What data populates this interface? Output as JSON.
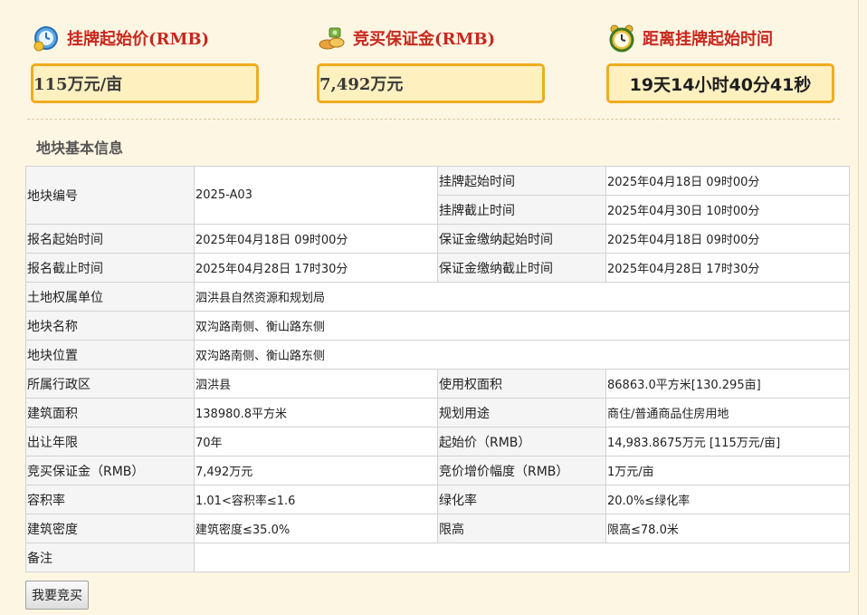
{
  "header": {
    "items": [
      {
        "icon": "clock-money-icon",
        "label": "挂牌起始价(RMB)",
        "value": "115万元/亩"
      },
      {
        "icon": "money-pile-icon",
        "label": "竞买保证金(RMB)",
        "value": "7,492万元"
      },
      {
        "icon": "alarm-clock-icon",
        "label": "距离挂牌起始时间",
        "value": "19天14小时40分41秒"
      }
    ],
    "label_color": "#c8281e",
    "box_border_color": "#f0ac20",
    "box_fill_color": "#fff0c0"
  },
  "section": {
    "title": "地块基本信息"
  },
  "table": {
    "r1": {
      "k1": "地块编号",
      "v1": "2025-A03",
      "k2a": "挂牌起始时间",
      "v2a": "2025年04月18日 09时00分",
      "k2b": "挂牌截止时间",
      "v2b": "2025年04月30日 10时00分"
    },
    "r2": {
      "k1": "报名起始时间",
      "v1": "2025年04月18日 09时00分",
      "k2": "保证金缴纳起始时间",
      "v2": "2025年04月18日 09时00分"
    },
    "r3": {
      "k1": "报名截止时间",
      "v1": "2025年04月28日 17时30分",
      "k2": "保证金缴纳截止时间",
      "v2": "2025年04月28日 17时30分"
    },
    "r4": {
      "k1": "土地权属单位",
      "v1": "泗洪县自然资源和规划局"
    },
    "r5": {
      "k1": "地块名称",
      "v1": "双沟路南侧、衡山路东侧"
    },
    "r6": {
      "k1": "地块位置",
      "v1": "双沟路南侧、衡山路东侧"
    },
    "r7": {
      "k1": "所属行政区",
      "v1": "泗洪县",
      "k2": "使用权面积",
      "v2": "86863.0平方米[130.295亩]"
    },
    "r8": {
      "k1": "建筑面积",
      "v1": "138980.8平方米",
      "k2": "规划用途",
      "v2": "商住/普通商品住房用地"
    },
    "r9": {
      "k1": "出让年限",
      "v1": "70年",
      "k2": "起始价（RMB）",
      "v2": "14,983.8675万元 [115万元/亩]"
    },
    "r10": {
      "k1": "竞买保证金（RMB）",
      "v1": "7,492万元",
      "k2": "竞价增价幅度（RMB）",
      "v2": "1万元/亩"
    },
    "r11": {
      "k1": "容积率",
      "v1": "1.01<容积率≤1.6",
      "k2": "绿化率",
      "v2": "20.0%≤绿化率"
    },
    "r12": {
      "k1": "建筑密度",
      "v1": "建筑密度≤35.0%",
      "k2": "限高",
      "v2": "限高≤78.0米"
    },
    "r13": {
      "k1": "备注",
      "v1": ""
    }
  },
  "actions": {
    "bid_label": "我要竞买"
  }
}
